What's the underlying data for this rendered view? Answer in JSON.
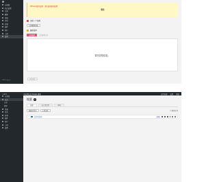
{
  "shot1": {
    "sidebar": {
      "items": [
        {
          "label": "仪表盘"
        },
        {
          "label": "站点设置"
        },
        {
          "label": "文章"
        },
        {
          "label": "媒体"
        },
        {
          "label": "页面"
        },
        {
          "label": "评论"
        },
        {
          "label": "外观"
        },
        {
          "label": "插件"
        },
        {
          "label": "用户"
        },
        {
          "label": "工具"
        },
        {
          "label": "设置"
        }
      ],
      "footer": "WPDesigner"
    },
    "notice": {
      "line": "WPvivid 缓存设置 · 请完成初始化配置",
      "bold": "警告"
    },
    "row1": {
      "text": "请求一个权限"
    },
    "row1_button": "立即重新授权",
    "row2": {
      "text": "最新版本"
    },
    "primary_button": "立即备份",
    "muted_text": "上次备份信息",
    "empty_text": "暂无存档信息。",
    "disabled_button": "批量操作"
  },
  "shot2": {
    "topbar": {
      "back": "< 返回",
      "title": "中文的站点 Design 选项",
      "right": [
        "文件管理",
        "设置",
        "帮助"
      ]
    },
    "sidebar": {
      "items": [
        {
          "label": "仪表盘"
        },
        {
          "label": "站点"
        },
        {
          "label": "文章"
        },
        {
          "label": "媒体"
        },
        {
          "label": "页面"
        },
        {
          "label": "评论"
        },
        {
          "label": "外观"
        },
        {
          "label": "插件"
        },
        {
          "label": "用户"
        },
        {
          "label": "工具"
        },
        {
          "label": "设置"
        }
      ]
    },
    "page_title": "档案",
    "tabs": [
      "全部",
      "已上传文件",
      "本地"
    ],
    "buttons": {
      "new_folder": "新建文件夹",
      "upload": "上传文件"
    },
    "search_label": "搜索文件",
    "file": {
      "name": "文件夹名称",
      "tag": "目录"
    }
  }
}
